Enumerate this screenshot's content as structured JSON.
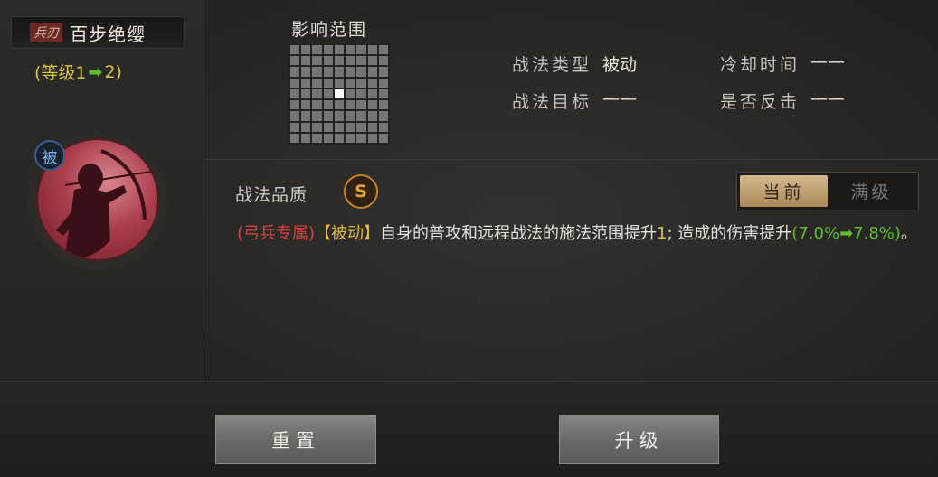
{
  "skill": {
    "type_tag": "兵刃",
    "name": "百步绝缨",
    "level_open": "(等级1",
    "level_arrow": "➡",
    "level_close": "2)",
    "passive_badge": "被"
  },
  "range": {
    "title": "影响范围",
    "grid_size": 9,
    "highlight_cell": 40
  },
  "attributes": [
    {
      "label": "战法类型",
      "value": "被动"
    },
    {
      "label": "冷却时间",
      "value": "——"
    },
    {
      "label": "战法目标",
      "value": "——"
    },
    {
      "label": "是否反击",
      "value": "——"
    }
  ],
  "quality": {
    "label": "战法品质",
    "grade": "S"
  },
  "toggle": {
    "current": "当前",
    "max": "满级"
  },
  "description": {
    "tag": "(弓兵专属)",
    "type": "【被动】",
    "text_a": "自身的普攻和远程战法的施法范围提升",
    "range_up": "1",
    "text_b": "; 造成的伤害提升",
    "pct_open": "(7.0%",
    "arrow": "➡",
    "pct_close": "7.8%)",
    "end": "。"
  },
  "buttons": {
    "reset": "重置",
    "upgrade": "升级"
  },
  "colors": {
    "accent_gold": "#d5b98e",
    "red_tag": "#d8443a",
    "green": "#5fbd2f",
    "yellow": "#d9c645",
    "quality_orange": "#e5a43a"
  }
}
